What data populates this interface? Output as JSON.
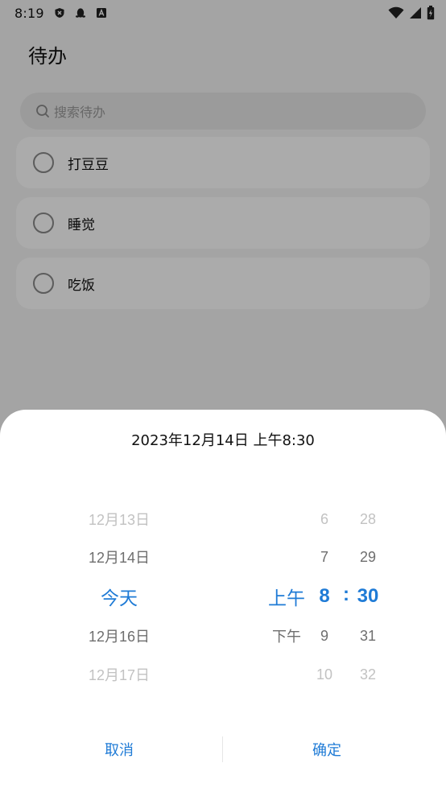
{
  "status_bar": {
    "time": "8:19",
    "left_icons": [
      "shield-icon",
      "penguin-icon",
      "font-icon"
    ],
    "right_icons": [
      "wifi-icon",
      "cellular-signal-icon",
      "battery-charging-icon"
    ]
  },
  "app": {
    "title": "待办",
    "search": {
      "placeholder": "搜索待办"
    },
    "todos": [
      {
        "text": "打豆豆",
        "done": false
      },
      {
        "text": "睡觉",
        "done": false
      },
      {
        "text": "吃饭",
        "done": false
      }
    ]
  },
  "picker": {
    "title": "2023年12月14日 上午8:30",
    "date_column": [
      "12月13日",
      "12月14日",
      "今天",
      "12月16日",
      "12月17日"
    ],
    "ampm_column": [
      "",
      "",
      "上午",
      "下午",
      ""
    ],
    "hour_column": [
      "6",
      "7",
      "8",
      "9",
      "10"
    ],
    "separator": ":",
    "minute_column": [
      "28",
      "29",
      "30",
      "31",
      "32"
    ],
    "cancel_label": "取消",
    "confirm_label": "确定"
  },
  "colors": {
    "accent": "#1f7bd6",
    "background": "#f5f5f5",
    "card": "#ffffff",
    "scrim": "rgba(0,0,0,0.33)"
  }
}
